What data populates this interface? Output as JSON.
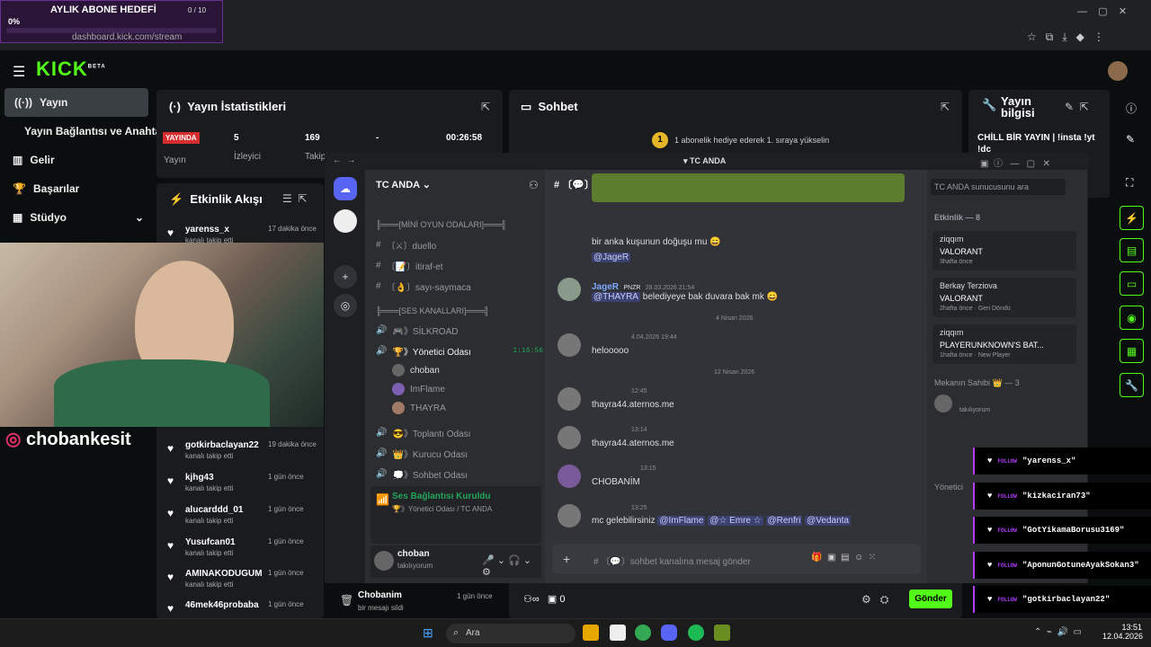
{
  "overlay": {
    "goal_title": "AYLIK ABONE HEDEFİ",
    "goal_count": "0 / 10",
    "goal_percent": "0%"
  },
  "browser": {
    "url": "dashboard.kick.com/stream"
  },
  "kick": {
    "logo": "KICK",
    "logo_sup": "BETA",
    "sidebar": [
      {
        "label": "Yayın",
        "icon": "broadcast-icon"
      },
      {
        "label": "Yayın Bağlantısı ve Anahtarı",
        "icon": ""
      },
      {
        "label": "Gelir",
        "icon": "chart-icon"
      },
      {
        "label": "Başarılar",
        "icon": "trophy-icon"
      },
      {
        "label": "Stüdyo",
        "icon": "grid-icon"
      }
    ],
    "stats": {
      "title": "Yayın İstatistikleri",
      "badge": "YAYINDA",
      "badge_sub": "Yayın",
      "viewers": "5",
      "viewers_label": "İzleyici",
      "followers": "169",
      "followers_label": "Takip",
      "dash": "-",
      "uptime": "00:26:58"
    },
    "chat": {
      "title": "Sohbet",
      "gift_msg": "1 abonelik hediye ederek 1. sıraya yükselin",
      "gift_rank": "1"
    },
    "stream_info": {
      "title": "Yayın bilgisi",
      "stream_title": "CHİLL BİR YAYIN | !insta !yt !dc"
    },
    "activity": {
      "title": "Etkinlik Akışı",
      "items": [
        {
          "name": "yarenss_x",
          "sub": "kanalı takip etti",
          "time": "17 dakika önce"
        },
        {
          "name": "gotkirbaclayan22",
          "sub": "kanalı takip etti",
          "time": "19 dakika önce"
        },
        {
          "name": "kjhg43",
          "sub": "kanalı takip etti",
          "time": "1 gün önce"
        },
        {
          "name": "alucarddd_01",
          "sub": "kanalı takip etti",
          "time": "1 gün önce"
        },
        {
          "name": "Yusufcan01",
          "sub": "kanalı takip etti",
          "time": "1 gün önce"
        },
        {
          "name": "AMINAKODUGUM",
          "sub": "kanalı takip etti",
          "time": "1 gün önce"
        },
        {
          "name": "46mek46probaba",
          "sub": "kanalı takip etti",
          "time": "1 gün önce"
        }
      ]
    },
    "deleted_msg": {
      "name": "Chobanim",
      "sub": "bir mesajı sildi",
      "time": "1 gün önce"
    },
    "chat_footer": {
      "points": "0",
      "send": "Gönder"
    },
    "handle": "chobankesit"
  },
  "discord": {
    "window_title": "TC ANDA",
    "server": "TC ANDA",
    "channel": "sohbet",
    "search_placeholder": "TC ANDA sunucusunu ara",
    "channels": [
      {
        "label": "╠═══[MİNİ OYUN ODALARI]═══╣",
        "type": "cat"
      },
      {
        "label": "〔⚔〕duello",
        "type": "text"
      },
      {
        "label": "〔📝〕itiraf-et",
        "type": "text"
      },
      {
        "label": "〔👌〕sayı-saymaca",
        "type": "text"
      },
      {
        "label": "╠═══[SES KANALLARI]═══╣",
        "type": "cat"
      },
      {
        "label": "🎮》SİLKROAD",
        "type": "voice"
      },
      {
        "label": "🏆》Yönetici Odası",
        "type": "voice-active",
        "timer": "1:16:56"
      },
      {
        "label": "choban",
        "type": "user"
      },
      {
        "label": "ImFlame",
        "type": "user"
      },
      {
        "label": "THAYRA",
        "type": "user"
      },
      {
        "label": "😎》Toplantı Odası",
        "type": "voice"
      },
      {
        "label": "👑》Kurucu Odası",
        "type": "voice"
      },
      {
        "label": "💭》Sohbet Odası",
        "type": "voice"
      }
    ],
    "voice_status": {
      "title": "Ses Bağlantısı Kuruldu",
      "sub": "🏆》Yönetici Odası / TC ANDA"
    },
    "user_panel": {
      "name": "choban",
      "status": "takılıyorum"
    },
    "messages": [
      {
        "text": "bir anka kuşunun doğuşu mu 😄",
        "mention": "@JageR"
      },
      {
        "author": "JageR",
        "tag": "PNZR",
        "time": "28.03.2026 21:54",
        "mention": "@THAYRA",
        "text": "belediyeye bak duvara bak mk 😄"
      },
      {
        "divider": "4 Nisan 2026"
      },
      {
        "time": "4.04.2026 19:44",
        "text": "helooooo"
      },
      {
        "divider": "12 Nisan 2026"
      },
      {
        "time": "12:45",
        "text": "thayra44.aternos.me"
      },
      {
        "time": "13:14",
        "text": "thayra44.aternos.me"
      },
      {
        "time": "13:15",
        "text": "CHOBANİM"
      },
      {
        "time": "13:25",
        "text": "mc gelebilirsiniz",
        "mentions": [
          "@ImFlame",
          "@☆ Emre ☆",
          "@Renfri",
          "@Vedanta"
        ]
      }
    ],
    "composer_placeholder": "sohbet kanalına mesaj gönder",
    "members": {
      "activity_header": "Etkinlik — 8",
      "cards": [
        {
          "user": "ziqqım",
          "game": "VALORANT",
          "time": "3hafta önce"
        },
        {
          "user": "Berkay Terziova",
          "game": "VALORANT",
          "time": "2hafta önce",
          "extra": "Geri Döndü"
        },
        {
          "user": "ziqqım",
          "game": "PLAYERUNKNOWN'S BAT...",
          "time": "1hafta önce",
          "extra": "New Player"
        }
      ],
      "owner_header": "Mekanın Sahibi 👑 — 3",
      "status": "takılıyorum",
      "admin_header": "Yönetici"
    }
  },
  "follows": [
    "\"yarenss_x\"",
    "\"kizkaciran73\"",
    "\"GotYikamaBorusu3169\"",
    "\"AponunGotuneAyakSokan3\"",
    "\"gotkirbaclayan22\""
  ],
  "follow_tag": "FOLLOW",
  "taskbar": {
    "search": "Ara",
    "time": "13:51",
    "date": "12.04.2026"
  }
}
